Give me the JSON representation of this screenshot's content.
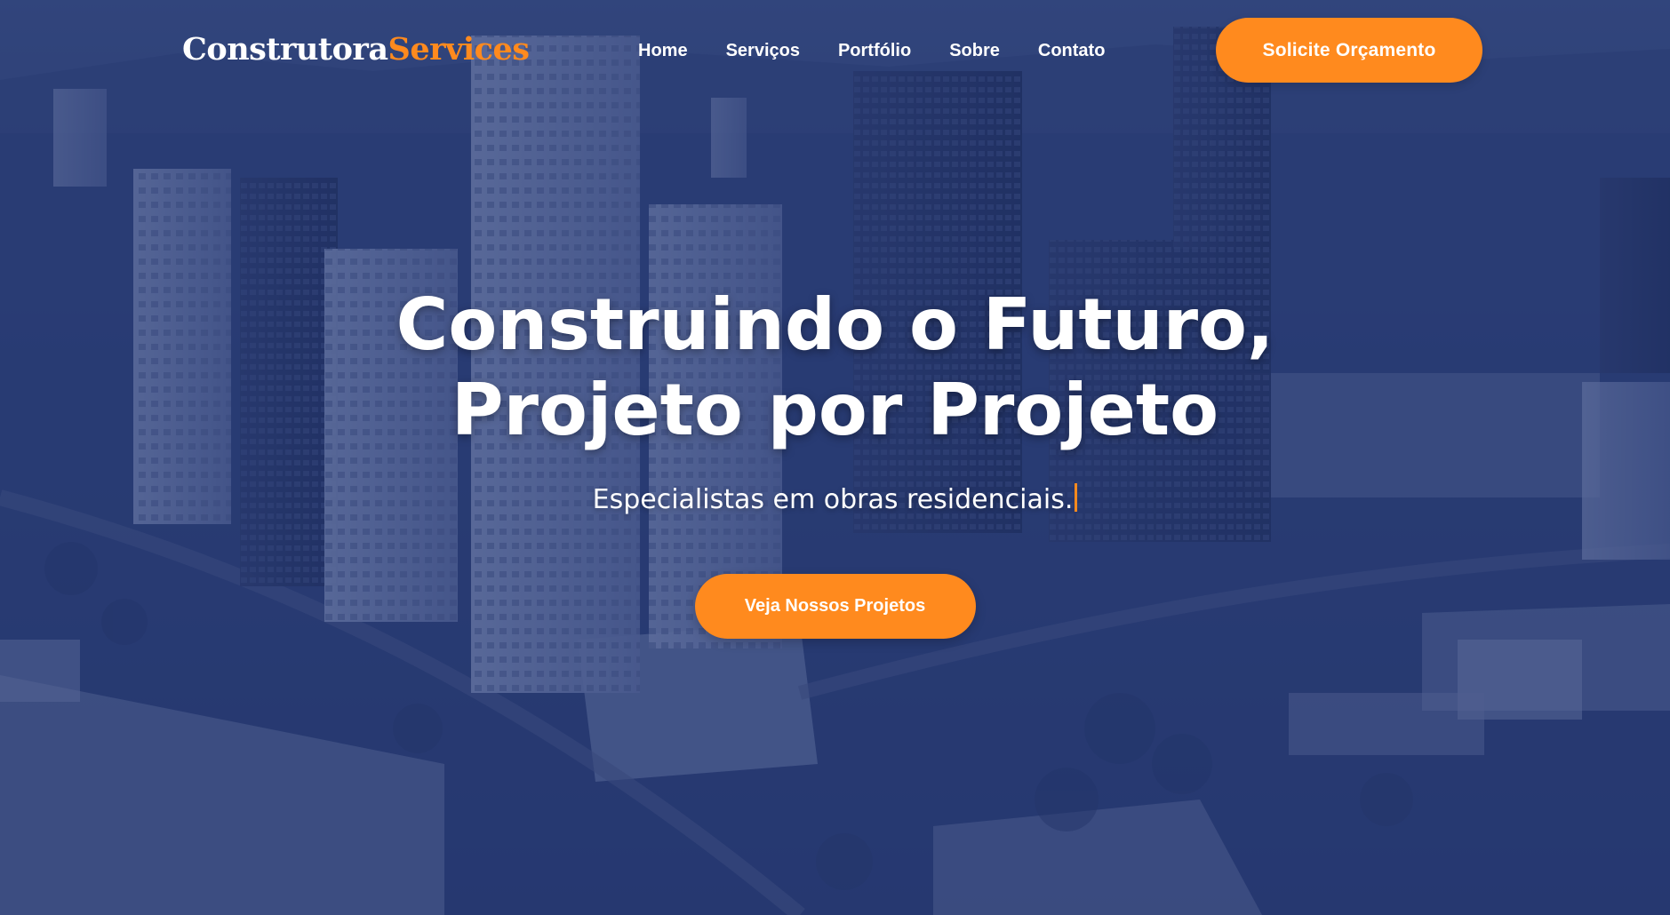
{
  "brand": {
    "name_part1": "Construtora",
    "name_part2": "Services",
    "accent_color": "#ff8a1e",
    "overlay_color": "#1e306e"
  },
  "nav": {
    "items": [
      {
        "label": "Home"
      },
      {
        "label": "Serviços"
      },
      {
        "label": "Portfólio"
      },
      {
        "label": "Sobre"
      },
      {
        "label": "Contato"
      }
    ],
    "cta_label": "Solicite Orçamento"
  },
  "hero": {
    "title_line1": "Construindo o Futuro,",
    "title_line2": "Projeto por Projeto",
    "subtitle": "Especialistas em obras residenciais.",
    "cta_label": "Veja Nossos Projetos",
    "background": "aerial-city-skyline-photo"
  }
}
